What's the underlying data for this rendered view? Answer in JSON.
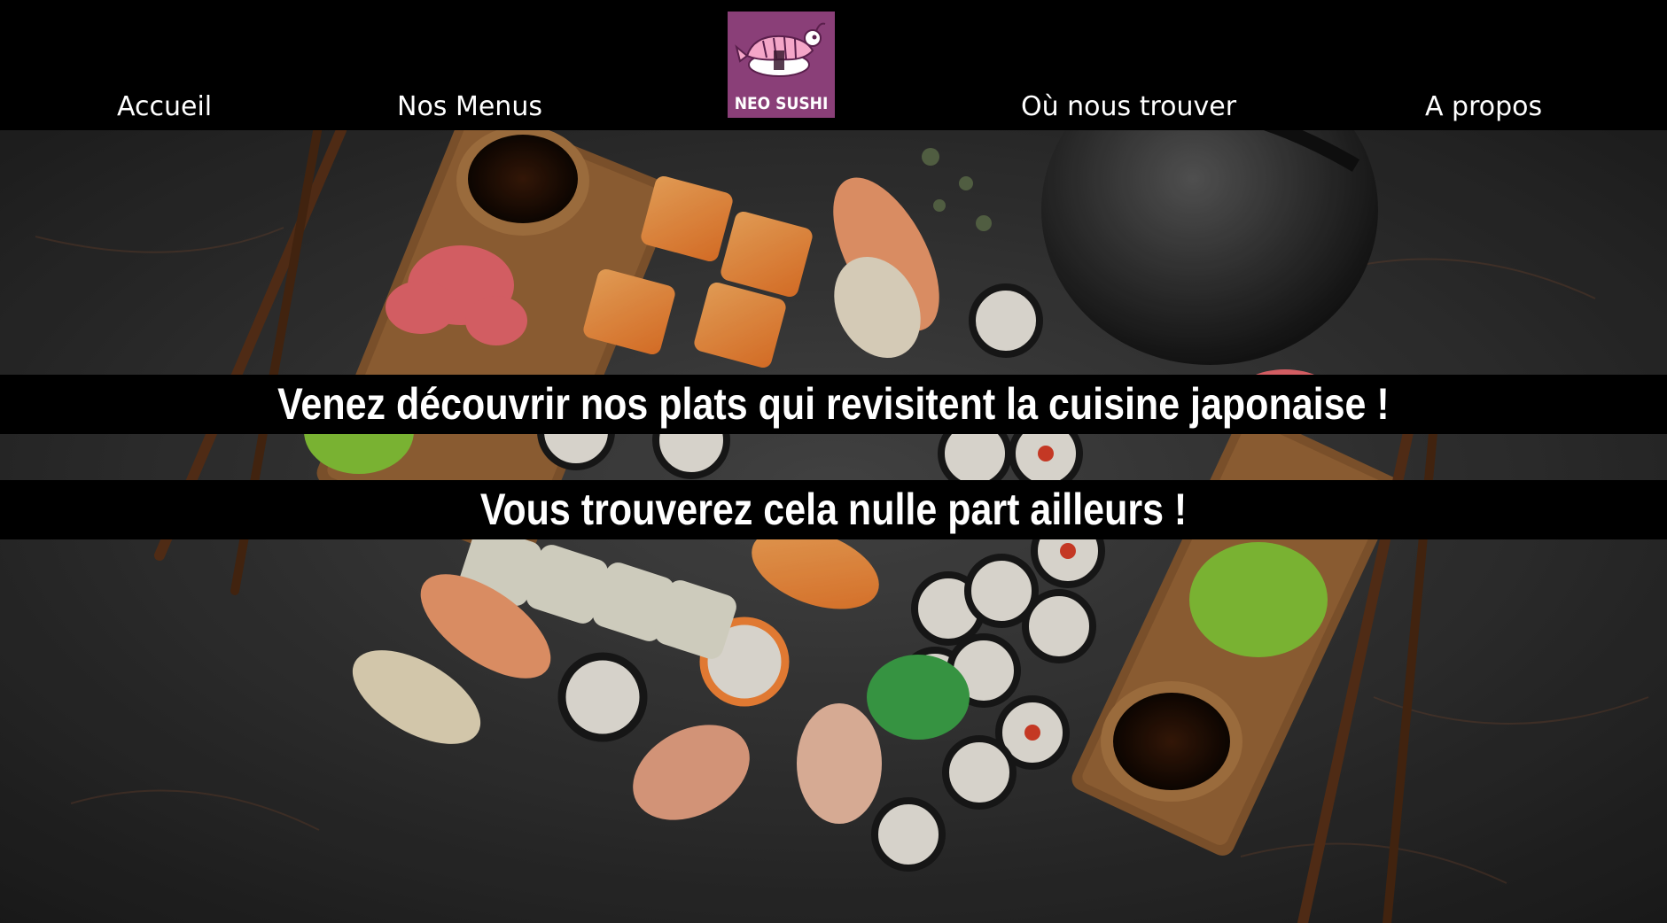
{
  "nav": {
    "items": [
      {
        "label": "Accueil"
      },
      {
        "label": "Nos Menus"
      },
      {
        "label": "Où nous trouver"
      },
      {
        "label": "A propos"
      }
    ],
    "logo": {
      "text": "NEO SUSHI",
      "icon": "shrimp-sushi-icon",
      "background": "#8a3f78"
    }
  },
  "hero": {
    "headline": "Venez découvrir nos plats qui revisitent la cuisine japonaise !",
    "subheadline": "Vous trouverez cela nulle part ailleurs !",
    "image": "sushi-platter-photo"
  },
  "colors": {
    "header_bg": "#000000",
    "text": "#ffffff",
    "logo_bg": "#8a3f78"
  }
}
